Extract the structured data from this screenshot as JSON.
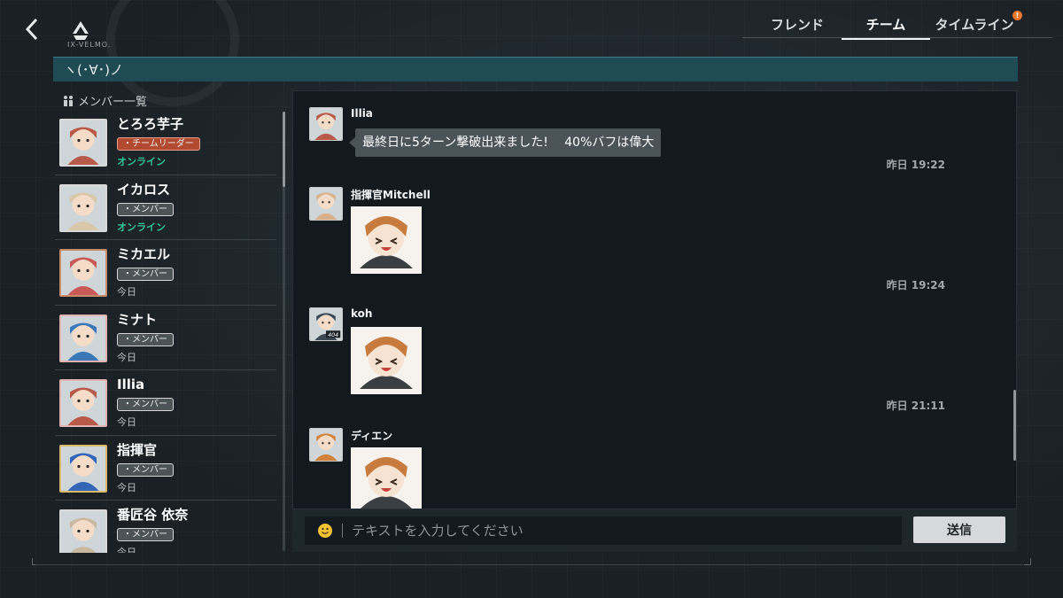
{
  "header": {
    "logo_text": "IX-VELMO.",
    "tabs": [
      {
        "label": "フレンド",
        "active": false,
        "badge": false
      },
      {
        "label": "チーム",
        "active": true,
        "badge": false
      },
      {
        "label": "タイムライン",
        "active": false,
        "badge": true
      }
    ],
    "badge_text": "!"
  },
  "team": {
    "name": "ヽ(･∀･)ノ"
  },
  "members_title": "メンバー一覧",
  "members": [
    {
      "name": "とろろ芋子",
      "role": "・チームリーダー",
      "leader": true,
      "status": "オンライン",
      "online": true,
      "avatar_color": "#b85a4a",
      "frame_color": "#d9d9d9"
    },
    {
      "name": "イカロス",
      "role": "・メンバー",
      "leader": false,
      "status": "オンライン",
      "online": true,
      "avatar_color": "#d8c7a8",
      "frame_color": "#d9d9d9"
    },
    {
      "name": "ミカエル",
      "role": "・メンバー",
      "leader": false,
      "status": "今日",
      "online": false,
      "avatar_color": "#c95a58",
      "frame_color": "#c88b6a"
    },
    {
      "name": "ミナト",
      "role": "・メンバー",
      "leader": false,
      "status": "今日",
      "online": false,
      "avatar_color": "#3a78b8",
      "frame_color": "#e3b3b3"
    },
    {
      "name": "Illia",
      "role": "・メンバー",
      "leader": false,
      "status": "今日",
      "online": false,
      "avatar_color": "#b85a4a",
      "frame_color": "#e3b3b3"
    },
    {
      "name": "指揮官",
      "role": "・メンバー",
      "leader": false,
      "status": "今日",
      "online": false,
      "avatar_color": "#3466b8",
      "frame_color": "#d9b86a"
    },
    {
      "name": "番匠谷 依奈",
      "role": "・メンバー",
      "leader": false,
      "status": "今日",
      "online": false,
      "avatar_color": "#c9b8a0",
      "frame_color": "#d9d9d9"
    }
  ],
  "messages": [
    {
      "sender": "Illia",
      "type": "text",
      "text": "最終日に5ターン撃破出来ました!　 40%バフは偉大",
      "avatar_color": "#b85a4a"
    },
    {
      "time": "昨日 19:22"
    },
    {
      "sender": "指揮官Mitchell",
      "type": "sticker",
      "sticker": "chibi-girl-smiling",
      "avatar_color": "#d8b08a"
    },
    {
      "time": "昨日 19:24"
    },
    {
      "sender": "koh",
      "type": "sticker",
      "sticker": "chibi-girl-laughing",
      "avatar_color": "#3d4a55",
      "avatar_badge": "404"
    },
    {
      "time": "昨日 21:11"
    },
    {
      "sender": "ディエン",
      "type": "sticker",
      "sticker": "chibi-girl-heart",
      "avatar_color": "#d2823a"
    }
  ],
  "input": {
    "placeholder": "テキストを入力してください",
    "value": "",
    "send_label": "送信"
  },
  "colors": {
    "accent_online": "#34c29b",
    "leader_tag": "#b24a31",
    "team_strip": "#1f4b55"
  }
}
